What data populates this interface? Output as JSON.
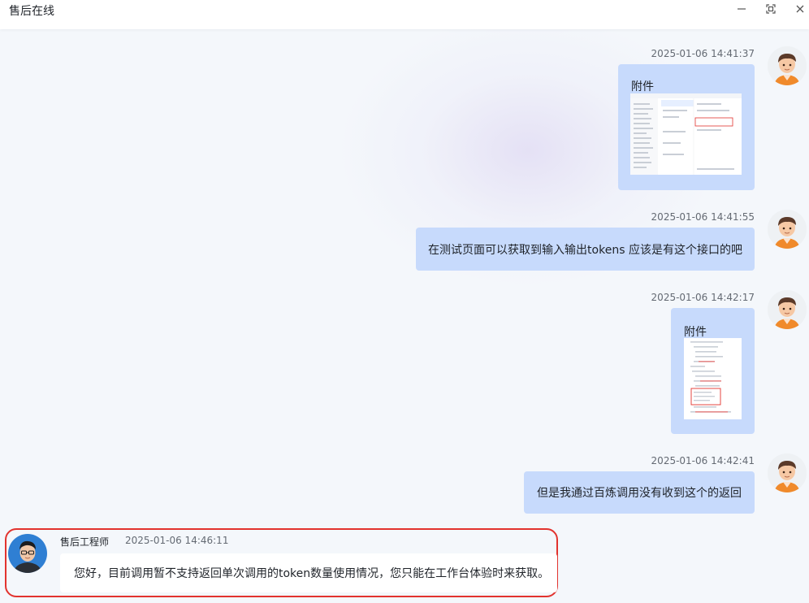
{
  "window": {
    "title": "售后在线",
    "controls": {
      "minimize_icon": "minimize-icon",
      "maximize_icon": "maximize-icon",
      "close_icon": "close-icon"
    }
  },
  "messages": [
    {
      "sender": "user",
      "time": "2025-01-06 14:41:37",
      "type": "attachment",
      "label": "附件"
    },
    {
      "sender": "user",
      "time": "2025-01-06 14:41:55",
      "type": "text",
      "text": "在测试页面可以获取到输入输出tokens  应该是有这个接口的吧"
    },
    {
      "sender": "user",
      "time": "2025-01-06 14:42:17",
      "type": "attachment",
      "label": "附件"
    },
    {
      "sender": "user",
      "time": "2025-01-06 14:42:41",
      "type": "text",
      "text": "但是我通过百炼调用没有收到这个的返回"
    }
  ],
  "agent_message": {
    "name": "售后工程师",
    "time": "2025-01-06 14:46:11",
    "text": "您好，目前调用暂不支持返回单次调用的token数量使用情况，您只能在工作台体验时来获取。"
  },
  "colors": {
    "user_bubble": "#c7dafc",
    "agent_bubble": "#ffffff",
    "highlight_border": "#e2332e",
    "background": "#f4f7fb"
  }
}
